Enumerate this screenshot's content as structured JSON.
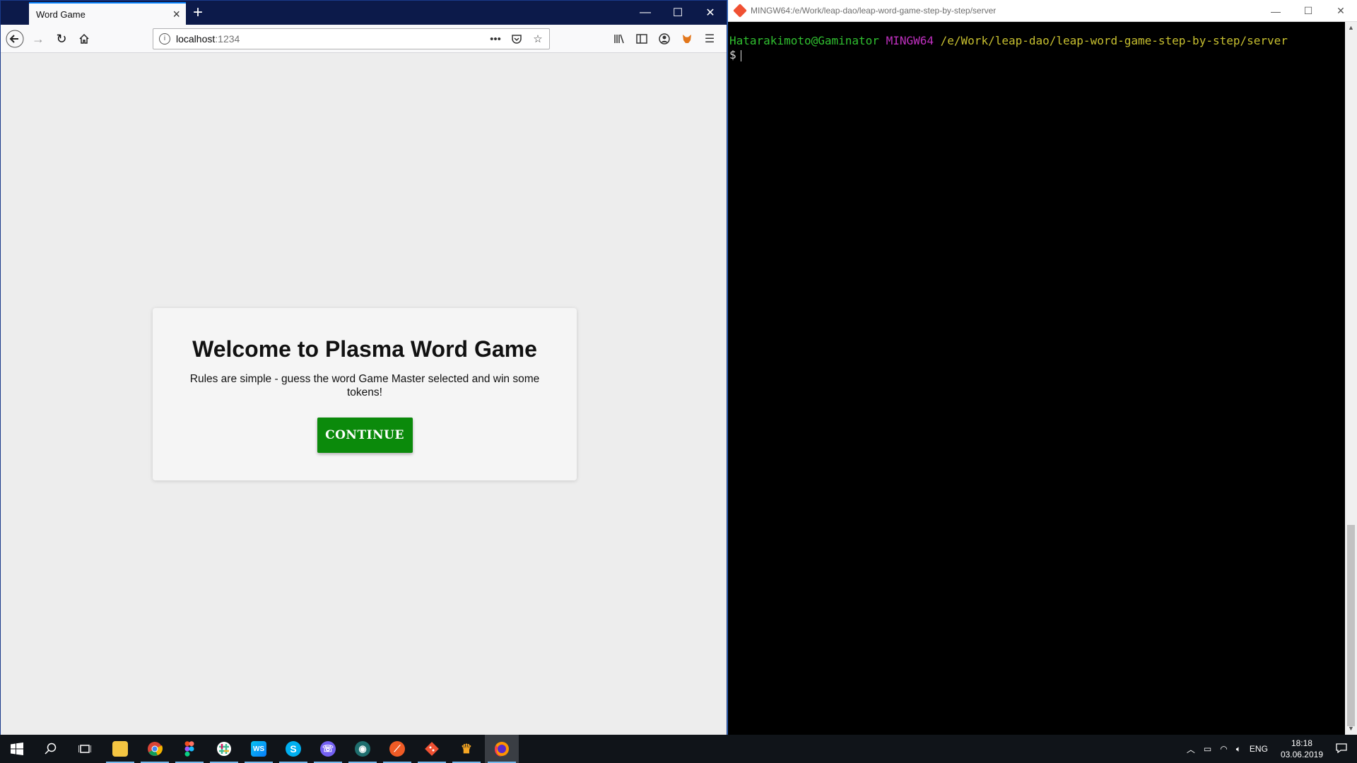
{
  "browser": {
    "tab_title": "Word Game",
    "url_host": "localhost",
    "url_port": ":1234"
  },
  "page": {
    "title": "Welcome to Plasma Word Game",
    "description": "Rules are simple - guess the word Game Master selected and win some tokens!",
    "continue_label": "CONTINUE"
  },
  "terminal": {
    "window_title": "MINGW64:/e/Work/leap-dao/leap-word-game-step-by-step/server",
    "user_host": "Hatarakimoto@Gaminator",
    "system": "MINGW64",
    "cwd": "/e/Work/leap-dao/leap-word-game-step-by-step/server",
    "prompt": "$"
  },
  "taskbar": {
    "language": "ENG",
    "time": "18:18",
    "date": "03.06.2019"
  },
  "colors": {
    "continue_button": "#0b8a0b",
    "terminal_user": "#30c030",
    "terminal_system": "#c030c0",
    "terminal_path": "#c8c030"
  }
}
